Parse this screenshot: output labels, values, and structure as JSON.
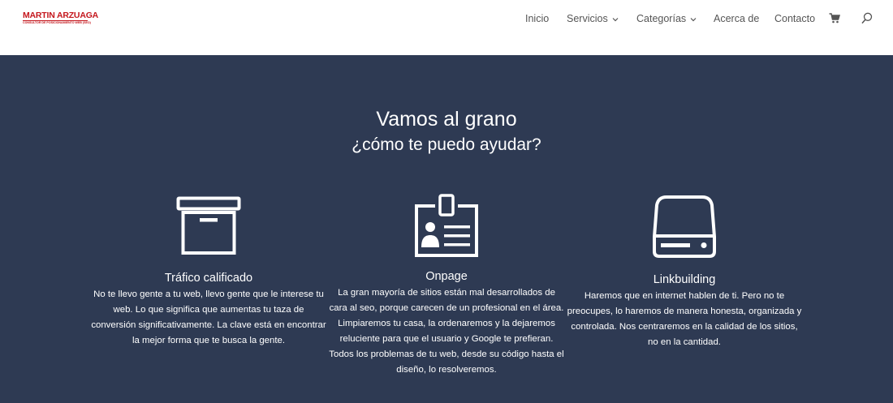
{
  "header": {
    "logo": {
      "name": "MARTIN ARZUAGA",
      "tagline": "CONSULTOR DE POSICIONAMIENTO WEB (SEO)"
    },
    "nav": [
      {
        "label": "Inicio",
        "has_dropdown": false
      },
      {
        "label": "Servicios",
        "has_dropdown": true
      },
      {
        "label": "Categorías",
        "has_dropdown": true
      },
      {
        "label": "Acerca de",
        "has_dropdown": false
      },
      {
        "label": "Contacto",
        "has_dropdown": false
      }
    ],
    "icons": {
      "cart": "cart-icon",
      "search": "search-icon"
    }
  },
  "section": {
    "background": "#2e3a53",
    "title": "Vamos al grano",
    "subtitle": "¿cómo te puedo ayudar?",
    "features": [
      {
        "icon": "archive-box-icon",
        "title": "Tráfico calificado",
        "text": "No te llevo gente a tu web, llevo gente que le interese tu web. Lo que significa que aumentas tu taza de conversión significativamente. La clave está en encontrar la mejor forma que te busca la gente."
      },
      {
        "icon": "id-badge-icon",
        "title": "Onpage",
        "text": "La gran mayoría de sitios están mal desarrollados de cara al seo, porque carecen de un profesional en el área. Limpiaremos tu casa, la ordenaremos y la dejaremos reluciente para que el usuario y Google te prefieran. Todos los problemas de tu web, desde su código hasta el diseño, lo resolveremos."
      },
      {
        "icon": "hard-drive-icon",
        "title": "Linkbuilding",
        "text": "Haremos que en internet hablen de ti. Pero no te preocupes, lo haremos de manera honesta, organizada y controlada. Nos centraremos en la calidad de los sitios, no en la cantidad."
      }
    ]
  }
}
